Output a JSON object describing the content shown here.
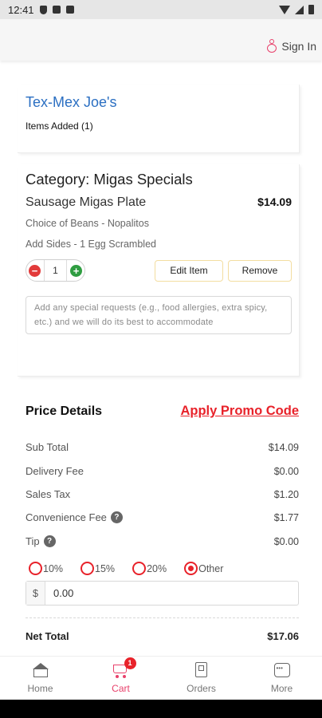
{
  "status_bar": {
    "time": "12:41"
  },
  "header": {
    "sign_in_label": "Sign In"
  },
  "restaurant": {
    "name": "Tex-Mex Joe's",
    "items_added": "Items Added (1)"
  },
  "item": {
    "category": "Category: Migas Specials",
    "name": "Sausage Migas Plate",
    "price": "$14.09",
    "options": [
      "Choice of Beans - Nopalitos",
      "Add Sides - 1 Egg Scrambled"
    ],
    "quantity": "1",
    "minus_symbol": "−",
    "plus_symbol": "+",
    "edit_label": "Edit Item",
    "remove_label": "Remove",
    "special_requests_placeholder": "Add any special requests (e.g., food allergies, extra spicy, etc.) and we will do its best to accommodate"
  },
  "price_details": {
    "title": "Price Details",
    "promo_label": "Apply Promo Code",
    "rows": [
      {
        "label": "Sub Total",
        "value": "$14.09"
      },
      {
        "label": "Delivery Fee",
        "value": "$0.00"
      },
      {
        "label": "Sales Tax",
        "value": "$1.20"
      },
      {
        "label": "Convenience Fee",
        "value": "$1.77"
      },
      {
        "label": "Tip",
        "value": "$0.00"
      }
    ],
    "help_symbol": "?",
    "tip_options": [
      "10%",
      "15%",
      "20%",
      "Other"
    ],
    "tip_selected": "Other",
    "tip_currency": "$",
    "tip_amount": "0.00",
    "net_total_label": "Net Total",
    "net_total_value": "$17.06"
  },
  "bottom_nav": {
    "items": [
      {
        "label": "Home",
        "icon": "home-icon"
      },
      {
        "label": "Cart",
        "icon": "cart-icon",
        "badge": "1",
        "active": true
      },
      {
        "label": "Orders",
        "icon": "orders-icon"
      },
      {
        "label": "More",
        "icon": "more-icon"
      }
    ]
  },
  "colors": {
    "accent": "#e8416b",
    "promo_red": "#e8222a",
    "link_blue": "#2b6fc2"
  }
}
